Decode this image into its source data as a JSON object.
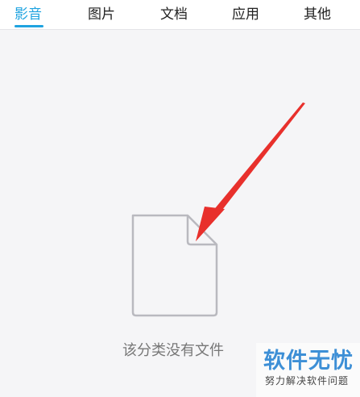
{
  "tabs": [
    {
      "label": "影音",
      "active": true
    },
    {
      "label": "图片",
      "active": false
    },
    {
      "label": "文档",
      "active": false
    },
    {
      "label": "应用",
      "active": false
    },
    {
      "label": "其他",
      "active": false
    }
  ],
  "empty_state": {
    "icon": "blank-file-icon",
    "message": "该分类没有文件"
  },
  "annotation": {
    "icon": "red-arrow-icon",
    "color": "#e8302c"
  },
  "watermark": {
    "title": "软件无忧",
    "subtitle": "努力解决软件问题",
    "color": "#3d8fd6"
  },
  "colors": {
    "accent": "#1fa3e0",
    "background": "#f5f5f7"
  }
}
